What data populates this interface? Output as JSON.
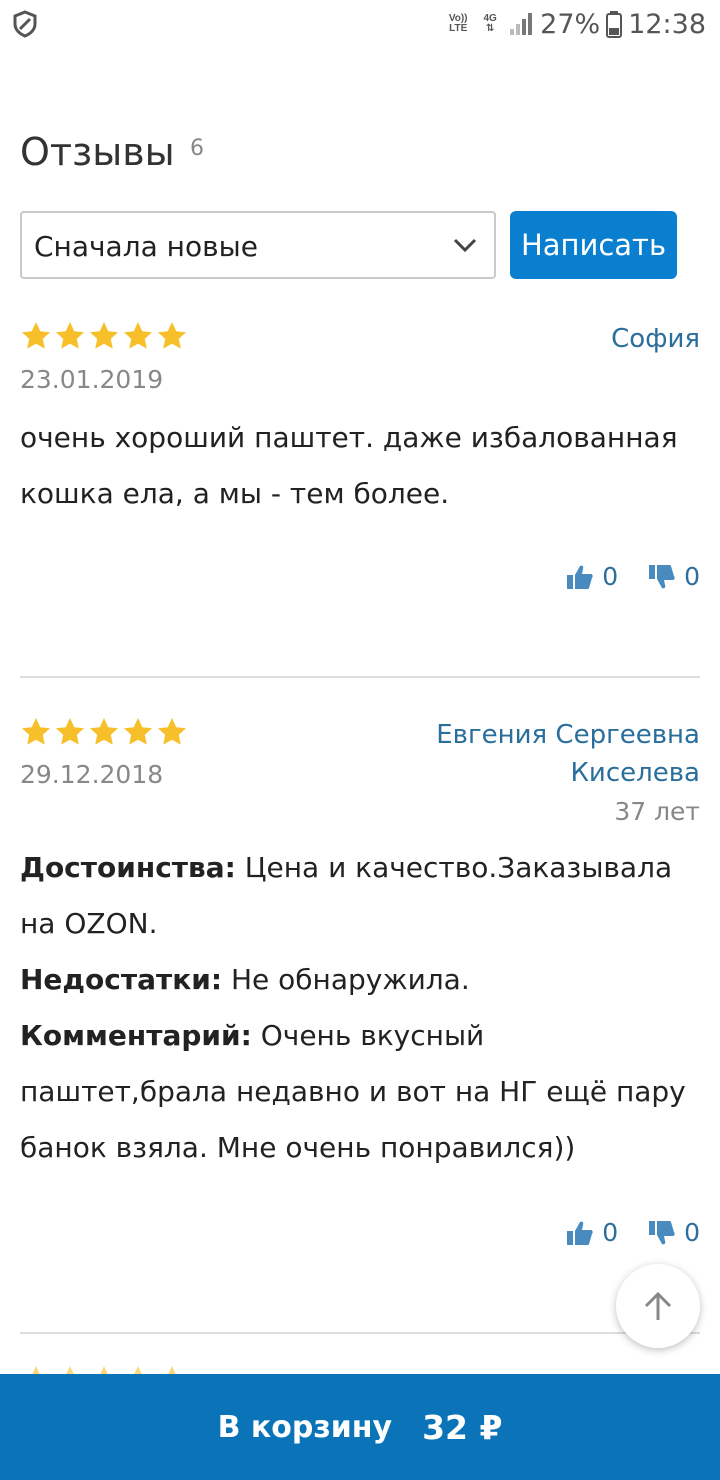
{
  "status_bar": {
    "volte": "Vo)) LTE",
    "network": "4G",
    "battery": "27%",
    "time": "12:38"
  },
  "reviews": {
    "title": "Отзывы",
    "count": "6",
    "sort_selected": "Сначала новые",
    "write_label": "Написать",
    "items": [
      {
        "rating": 5,
        "author": "София",
        "date": "23.01.2019",
        "text": "очень хороший паштет. даже избалованная кошка ела, а мы - тем более.",
        "likes": "0",
        "dislikes": "0"
      },
      {
        "rating": 5,
        "author_line1": "Евгения Сергеевна",
        "author_line2": "Киселева",
        "age": "37 лет",
        "date": "29.12.2018",
        "pros_label": "Достоинства:",
        "pros": "Цена и качество.Заказывала на OZON.",
        "cons_label": "Недостатки:",
        "cons": "Не обнаружила.",
        "comment_label": "Комментарий:",
        "comment": "Очень вкусный паштет,брала недавно и вот на НГ ещё пару банок взяла. Мне очень понравился))",
        "likes": "0",
        "dislikes": "0"
      }
    ]
  },
  "cart": {
    "label": "В корзину",
    "price": "32 ₽"
  },
  "icons": {
    "shield": "shield-icon",
    "star": "star-icon",
    "thumb_up": "thumbs-up-icon",
    "thumb_down": "thumbs-down-icon",
    "chevron": "chevron-down-icon",
    "scroll_top": "arrow-up-icon"
  },
  "colors": {
    "accent": "#0a7fd0",
    "cart": "#0b74b8",
    "link": "#2a6f9c",
    "star": "#f7c02a"
  }
}
